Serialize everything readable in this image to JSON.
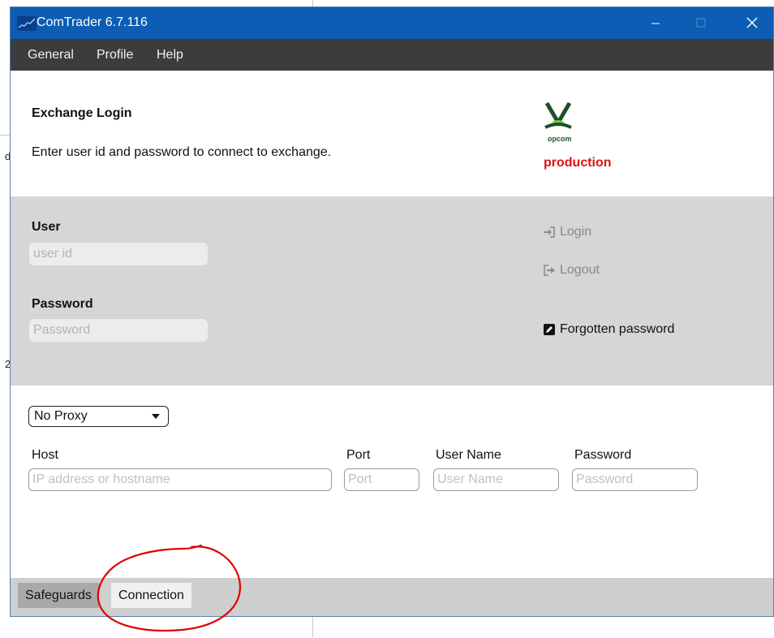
{
  "window": {
    "title": "ComTrader 6.7.116"
  },
  "menu": {
    "items": [
      "General",
      "Profile",
      "Help"
    ]
  },
  "header": {
    "title": "Exchange Login",
    "description": "Enter user id and password to connect to exchange.",
    "logo_text": "opcom",
    "environment": "production",
    "environment_color": "#e01010"
  },
  "login": {
    "user_label": "User",
    "user_placeholder": "user id",
    "password_label": "Password",
    "password_placeholder": "Password",
    "login_label": "Login",
    "logout_label": "Logout",
    "forgotten_label": "Forgotten password"
  },
  "proxy": {
    "selected": "No Proxy",
    "host_label": "Host",
    "host_placeholder": "IP address or hostname",
    "port_label": "Port",
    "port_placeholder": "Port",
    "username_label": "User Name",
    "username_placeholder": "User Name",
    "password_label": "Password",
    "password_placeholder": "Password"
  },
  "tabs": [
    {
      "label": "Safeguards",
      "active": false
    },
    {
      "label": "Connection",
      "active": true
    }
  ],
  "colors": {
    "titlebar": "#0c5db3",
    "menubar": "#3c3c3c",
    "panel": "#d6d6d6",
    "annotation": "#e00000"
  }
}
